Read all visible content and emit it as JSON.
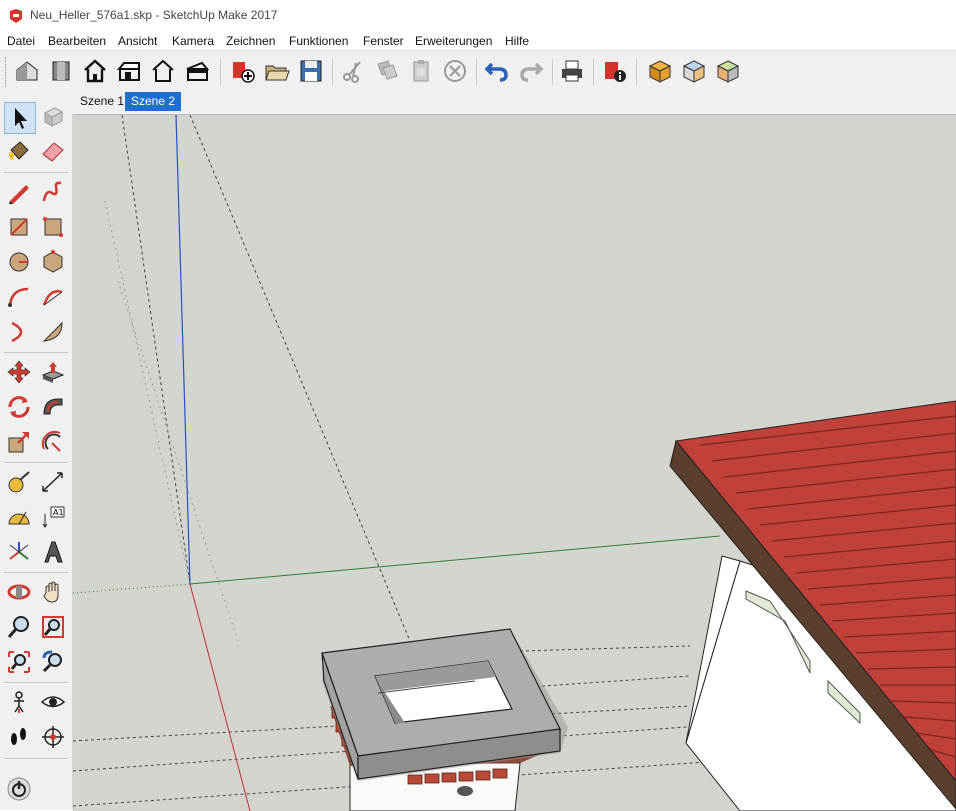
{
  "window": {
    "title": "Neu_Heller_576a1.skp - SketchUp Make 2017"
  },
  "menu": [
    "Datei",
    "Bearbeiten",
    "Ansicht",
    "Kamera",
    "Zeichnen",
    "Funktionen",
    "Fenster",
    "Erweiterungen",
    "Hilfe"
  ],
  "scenes": [
    "Szene 1",
    "Szene 2"
  ],
  "active_scene": "Szene 2",
  "colors": {
    "roof": "#c0403a",
    "roof_fascia": "#5a3f2e",
    "concrete": "#9a9a98",
    "sky": "#d4d4cf",
    "tab_active": "#1e6fd0",
    "axis_blue": "#2a4fbf",
    "axis_red": "#c03030",
    "axis_green": "#2f7a3a"
  }
}
